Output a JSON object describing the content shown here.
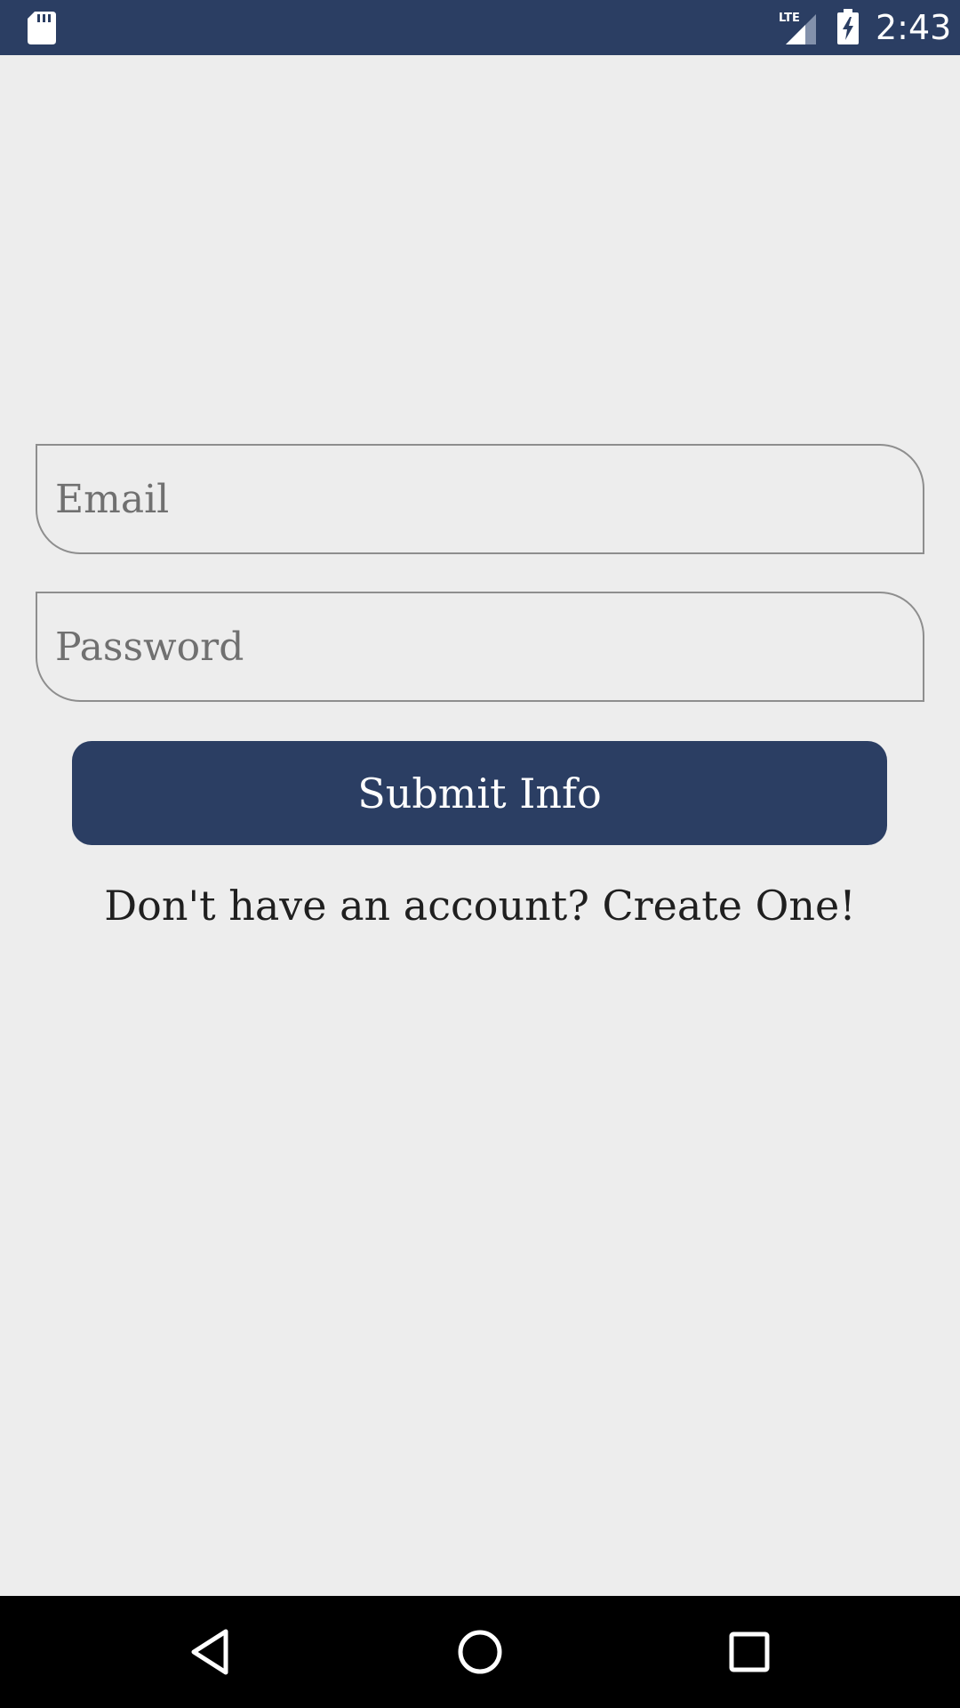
{
  "status_bar": {
    "time": "2:43",
    "network": "LTE",
    "icons": [
      "sd-card-icon",
      "lte-signal-icon",
      "battery-charging-icon"
    ],
    "background": "#2b3e63"
  },
  "form": {
    "email_placeholder": "Email",
    "email_value": "",
    "password_placeholder": "Password",
    "password_value": "",
    "submit_label": "Submit Info",
    "create_account_text": "Don't have an account? Create One!"
  },
  "nav_bar": {
    "icons": [
      "back-icon",
      "home-icon",
      "recent-apps-icon"
    ]
  },
  "colors": {
    "accent": "#2b3e63",
    "background": "#ededed",
    "field_border": "#8e8e8e"
  }
}
